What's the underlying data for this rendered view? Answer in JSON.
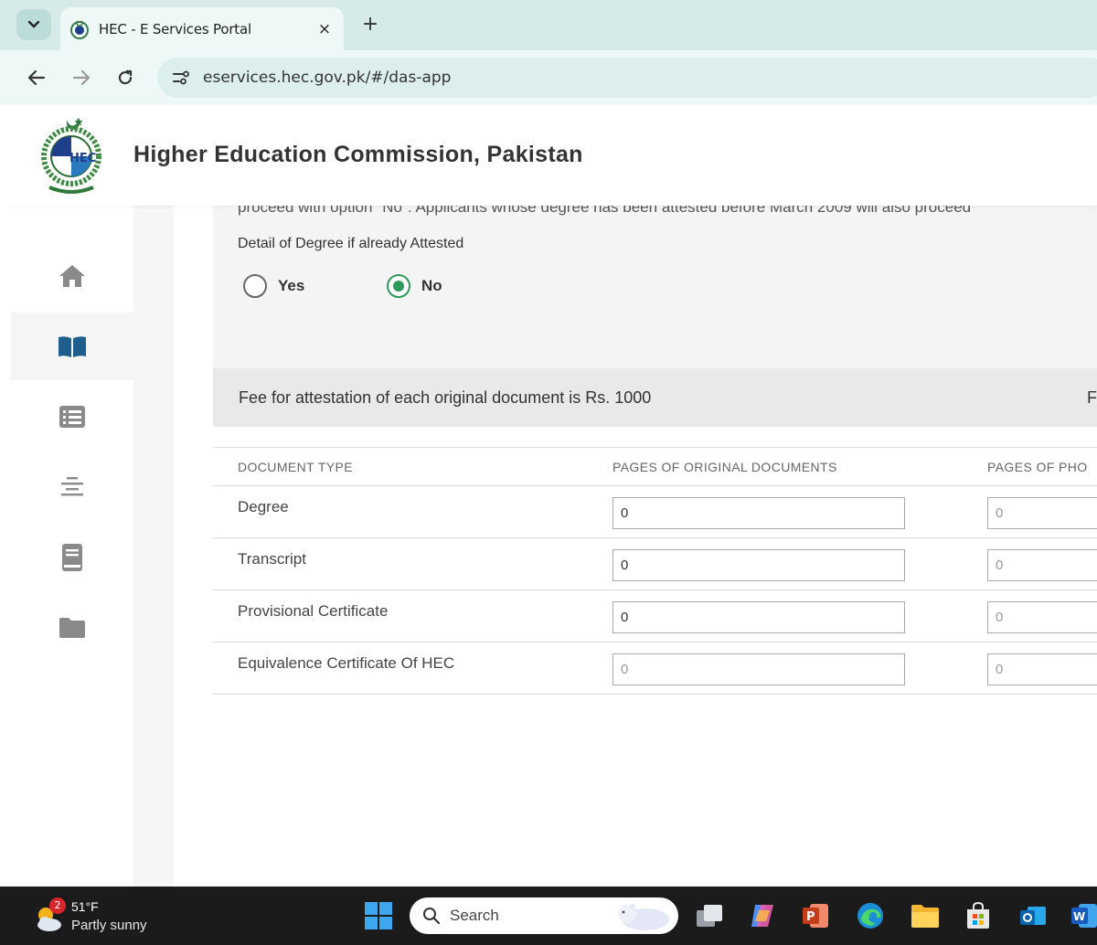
{
  "browser": {
    "tab_title": "HEC - E Services Portal",
    "tab_close": "×",
    "new_tab": "+",
    "url": "eservices.hec.gov.pk/#/das-app"
  },
  "header": {
    "site_title": "Higher Education Commission, Pakistan"
  },
  "sidebar": {
    "items": [
      {
        "icon": "home-icon",
        "active": false
      },
      {
        "icon": "book-open-icon",
        "active": true
      },
      {
        "icon": "list-icon",
        "active": false
      },
      {
        "icon": "align-center-icon",
        "active": false
      },
      {
        "icon": "book-icon",
        "active": false
      },
      {
        "icon": "folder-icon",
        "active": false
      }
    ]
  },
  "attestation": {
    "cut_text": "proceed with option \"No\". Applicants whose degree has been attested before March 2009 will also proceed",
    "question": "Detail of Degree if already Attested",
    "options": [
      {
        "label": "Yes",
        "selected": false
      },
      {
        "label": "No",
        "selected": true
      }
    ],
    "accent_color": "#2e9a5a"
  },
  "fee": {
    "text": "Fee for attestation of each original document is Rs. 1000",
    "right_cut": "F"
  },
  "table": {
    "headers": [
      "DOCUMENT TYPE",
      "PAGES OF ORIGINAL DOCUMENTS",
      "PAGES OF PHO"
    ],
    "rows": [
      {
        "label": "Degree",
        "original": "0",
        "photo": "0",
        "original_disabled": false
      },
      {
        "label": "Transcript",
        "original": "0",
        "photo": "0",
        "original_disabled": false
      },
      {
        "label": "Provisional Certificate",
        "original": "0",
        "photo": "0",
        "original_disabled": false
      },
      {
        "label": "Equivalence Certificate Of HEC",
        "original": "0",
        "photo": "0",
        "original_disabled": true
      }
    ]
  },
  "taskbar": {
    "weather_badge": "2",
    "weather_temp": "51°F",
    "weather_desc": "Partly sunny",
    "search_label": "Search",
    "apps": [
      "start-icon",
      "task-view-icon",
      "copilot-icon",
      "powerpoint-icon",
      "edge-icon",
      "file-explorer-icon",
      "store-icon",
      "outlook-icon",
      "word-icon"
    ]
  }
}
